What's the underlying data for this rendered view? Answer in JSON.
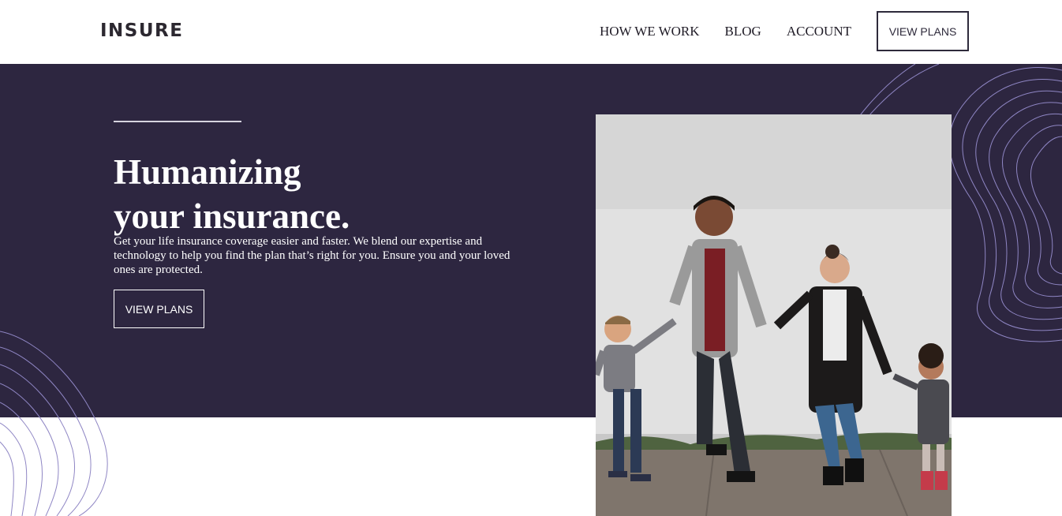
{
  "header": {
    "logo_text": "INSURE",
    "nav": [
      {
        "label": "HOW WE WORK"
      },
      {
        "label": "BLOG"
      },
      {
        "label": "ACCOUNT"
      }
    ],
    "cta_label": "VIEW PLANS"
  },
  "hero": {
    "title_line1": "Humanizing",
    "title_line2": "your insurance.",
    "description": "Get your life insurance coverage easier and faster. We blend our expertise and technology to help you find the plan that’s right for you. Ensure you and your loved ones are protected.",
    "button_label": "VIEW PLANS"
  },
  "colors": {
    "hero_bg": "#2d2640",
    "swirl": "#8f86c4"
  },
  "icons": {
    "photo": "family-photo"
  }
}
